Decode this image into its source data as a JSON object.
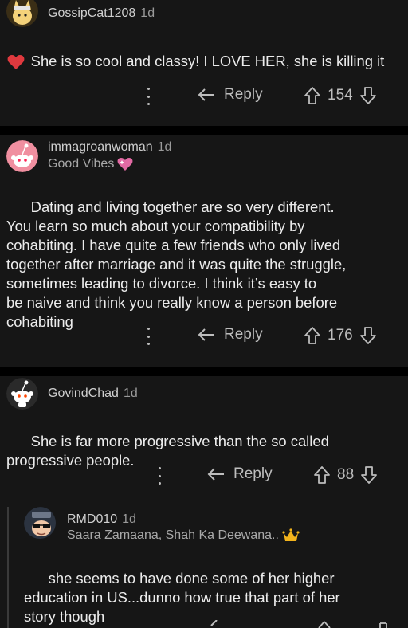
{
  "comments": [
    {
      "username": "GossipCat1208",
      "age": "1d",
      "body": "She is so cool and classy! I LOVE HER, she is killing it",
      "heart": "❤️",
      "reply_label": "Reply",
      "score": "154"
    },
    {
      "username": "immagroanwoman",
      "age": "1d",
      "flair": "Good Vibes",
      "body": "Dating and living together are so very different.\nYou learn so much about your compatibility by\ncohabiting. I have quite a few friends who only lived\ntogether after marriage and it was quite the struggle,\nsometimes leading to divorce. I think it’s easy to\nbe naive and think you really know a person before\ncohabiting",
      "reply_label": "Reply",
      "score": "176"
    },
    {
      "username": "GovindChad",
      "age": "1d",
      "body": "She is far more progressive than the so called\nprogressive people.",
      "reply_label": "Reply",
      "score": "88"
    },
    {
      "username": "RMD010",
      "age": "1d",
      "flair": "Saara Zamaana, Shah Ka Deewana..",
      "body": "she seems to have done some of her higher\neducation in US...dunno how true that part of her\nstory though"
    }
  ],
  "colors": {
    "background": "#0b0b0b",
    "card": "#161616",
    "heart": "#e0393e",
    "flair_heart": "#e26aa4",
    "crown": "#f2b31c"
  },
  "icons": [
    "overflow-menu-icon",
    "reply-arrow-icon",
    "upvote-icon",
    "downvote-icon",
    "heart-icon",
    "crown-icon"
  ]
}
